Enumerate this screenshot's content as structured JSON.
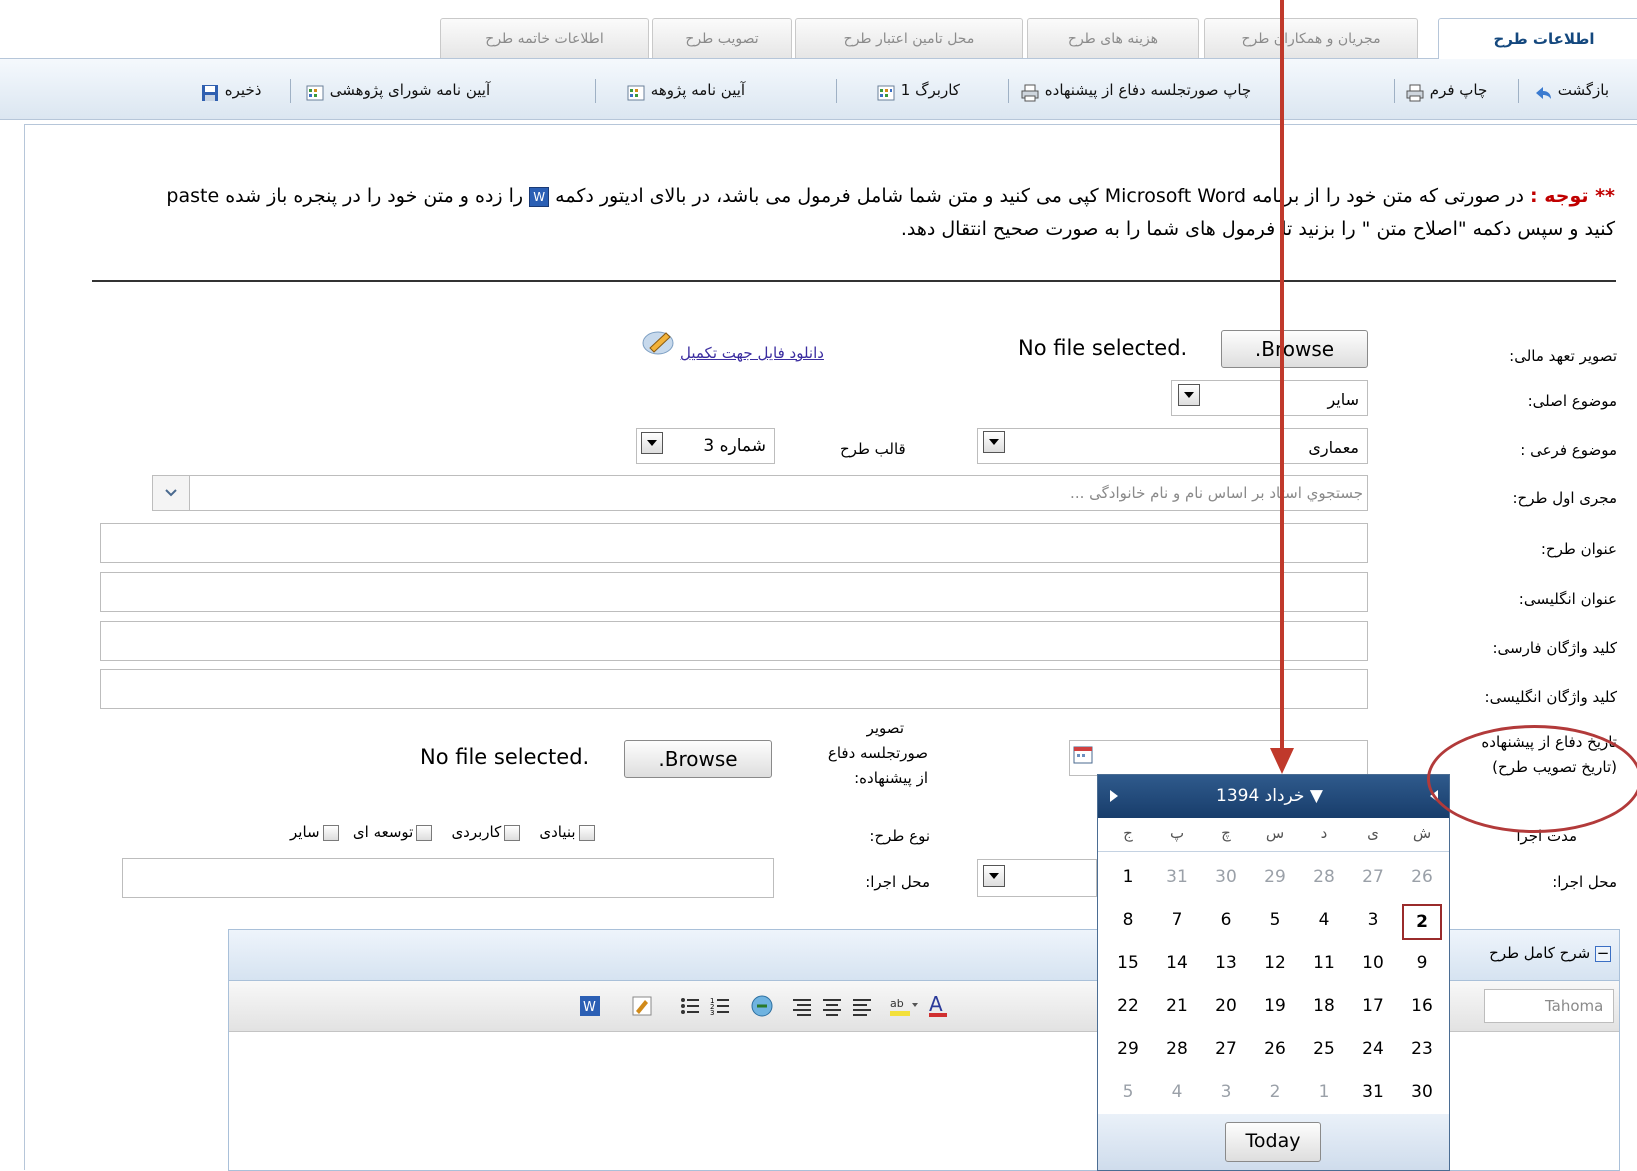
{
  "tabs": [
    {
      "label": "اطلاعات طرح",
      "active": true
    },
    {
      "label": "مجریان و همکاران طرح"
    },
    {
      "label": "هزینه های طرح"
    },
    {
      "label": "محل تامین اعتبار طرح"
    },
    {
      "label": "تصویب طرح"
    },
    {
      "label": "اطلاعات خاتمه طرح"
    }
  ],
  "toolbar": {
    "back": "بازگشت",
    "print_form": "چاپ فرم",
    "print_minutes": "چاپ صورتجلسه دفاع از پیشنهاده",
    "workbook": "کاربرگ 1",
    "research_bylaw": "آیین نامه پژوهه",
    "council_bylaw": "آیین نامه شورای پژوهشی",
    "save": "ذخیره"
  },
  "notice": {
    "star": "** توجه :",
    "text": " در صورتی که متن خود را از برنامه Microsoft Word کپی می کنید و متن شما شامل فرمول می باشد، در بالای ادیتور دکمه ",
    "text2": " را زده و متن خود را در پنجره باز شده paste کنید و سپس دکمه \"اصلاح متن \" را بزنید تا فرمول های شما را به صورت صحیح انتقال دهد."
  },
  "form": {
    "financial_image_label": "تصویر تعهد مالی:",
    "browse": ".Browse",
    "no_file": "No file selected.",
    "download_link": "دانلود فایل جهت تکمیل",
    "main_subject_label": "موضوع اصلی:",
    "main_subject_value": "سایر",
    "sub_subject_label": "موضوع فرعی :",
    "sub_subject_value": "معماری",
    "template_label": "قالب طرح",
    "template_value": "شماره 3",
    "first_executor_label": "مجری اول طرح:",
    "first_executor_placeholder": "جستجوي استاد بر اساس نام و نام خانوادگی ...",
    "title_label": "عنوان طرح:",
    "english_title_label": "عنوان انگلیسی:",
    "fa_keywords_label": "کلید واژگان فارسی:",
    "en_keywords_label": "کلید واژگان انگلیسی:",
    "defense_date_label": "تاریخ دفاع از پیشنهاده",
    "defense_date_sub": "(تاریخ تصویب طرح)",
    "minutes_image_label_1": "تصویر",
    "minutes_image_label_2": "صورتجلسه دفاع",
    "minutes_image_label_3": "از پیشنهاده:",
    "duration_label": "مدت اجرا",
    "type_label": "نوع طرح:",
    "type_options": [
      "بنیادی",
      "کاربردی",
      "توسعه ای",
      "سایر"
    ],
    "location_label": "محل اجرا:",
    "location_label2": "محل اجرا:",
    "full_desc_label": "شرح کامل طرح",
    "font_value": "Tahoma"
  },
  "calendar": {
    "month": "خرداد 1394",
    "weekdays": [
      "ش",
      "ی",
      "د",
      "س",
      "چ",
      "پ",
      "ج"
    ],
    "rows": [
      [
        "26",
        "27",
        "28",
        "29",
        "30",
        "31",
        "1"
      ],
      [
        "2",
        "3",
        "4",
        "5",
        "6",
        "7",
        "8"
      ],
      [
        "9",
        "10",
        "11",
        "12",
        "13",
        "14",
        "15"
      ],
      [
        "16",
        "17",
        "18",
        "19",
        "20",
        "21",
        "22"
      ],
      [
        "23",
        "24",
        "25",
        "26",
        "27",
        "28",
        "29"
      ],
      [
        "30",
        "31",
        "1",
        "2",
        "3",
        "4",
        "5"
      ]
    ],
    "today": "Today"
  },
  "colors": {
    "accent": "#14487e",
    "annotation": "#b23a3a"
  }
}
